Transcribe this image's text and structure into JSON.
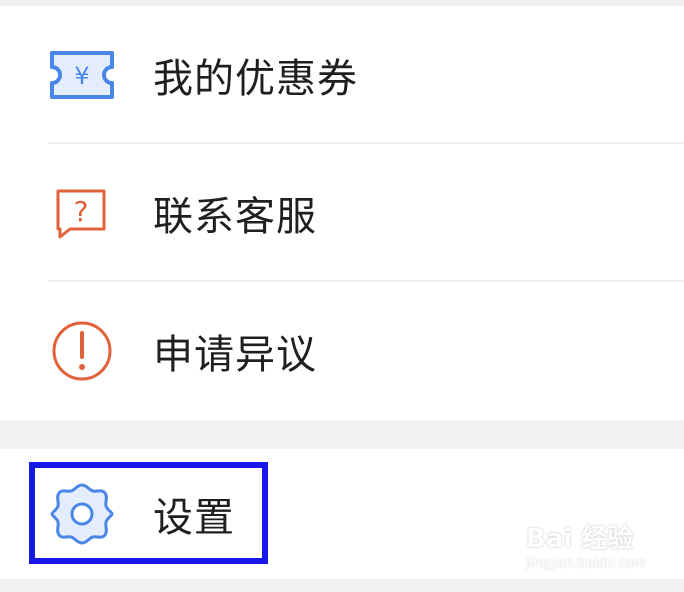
{
  "menu": {
    "items": [
      {
        "label": "我的优惠券",
        "icon": "coupon-icon",
        "icon_color": "#4a86e8"
      },
      {
        "label": "联系客服",
        "icon": "help-chat-icon",
        "icon_color": "#e0623a"
      },
      {
        "label": "申请异议",
        "icon": "exclamation-circle-icon",
        "icon_color": "#e0623a"
      }
    ]
  },
  "settings": {
    "label": "设置",
    "icon": "gear-icon",
    "icon_color": "#4a86e8"
  },
  "highlight_color": "#1818e6",
  "watermark": {
    "main": "Bai 经验",
    "sub": "jingyan.baidu.com"
  }
}
